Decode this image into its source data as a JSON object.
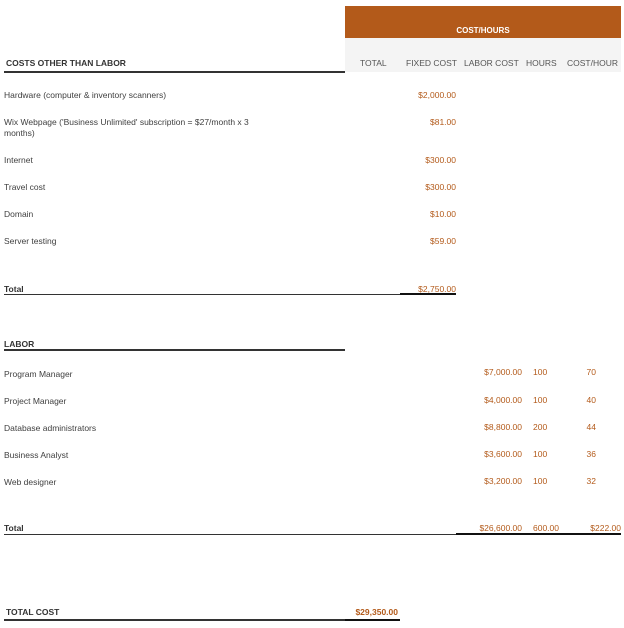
{
  "header": {
    "band": "COST/HOURS",
    "columns": {
      "total": "TOTAL",
      "fixed_cost": "FIXED COST",
      "labor_cost": "LABOR COST",
      "hours": "HOURS",
      "cost_hour": "COST/HOUR"
    }
  },
  "other_costs": {
    "title": "COSTS OTHER THAN LABOR",
    "items": [
      {
        "label": "Hardware (computer & inventory scanners)",
        "fixed_cost": "$2,000.00"
      },
      {
        "label_line1": "Wix Webpage ('Business Unlimited' subscription = $27/month x 3",
        "label_line2": "months)",
        "fixed_cost": "$81.00"
      },
      {
        "label": "Internet",
        "fixed_cost": "$300.00"
      },
      {
        "label": "Travel cost",
        "fixed_cost": "$300.00"
      },
      {
        "label": "Domain",
        "fixed_cost": "$10.00"
      },
      {
        "label": "Server testing",
        "fixed_cost": "$59.00"
      }
    ],
    "total_label": "Total",
    "total_fixed_cost": "$2,750.00"
  },
  "labor": {
    "title": "LABOR",
    "items": [
      {
        "label": "Program Manager",
        "labor_cost": "$7,000.00",
        "hours": "100",
        "cost_hour": "70"
      },
      {
        "label": "Project Manager",
        "labor_cost": "$4,000.00",
        "hours": "100",
        "cost_hour": "40"
      },
      {
        "label": "Database administrators",
        "labor_cost": "$8,800.00",
        "hours": "200",
        "cost_hour": "44"
      },
      {
        "label": "Business Analyst",
        "labor_cost": "$3,600.00",
        "hours": "100",
        "cost_hour": "36"
      },
      {
        "label": "Web designer",
        "labor_cost": "$3,200.00",
        "hours": "100",
        "cost_hour": "32"
      }
    ],
    "total_label": "Total",
    "total_labor_cost": "$26,600.00",
    "total_hours": "600.00",
    "total_cost_hour": "$222.00"
  },
  "grand_total": {
    "label": "TOTAL COST",
    "value": "$29,350.00"
  },
  "colors": {
    "accent": "#b35a1a",
    "header_bg": "#f4f4f4"
  }
}
